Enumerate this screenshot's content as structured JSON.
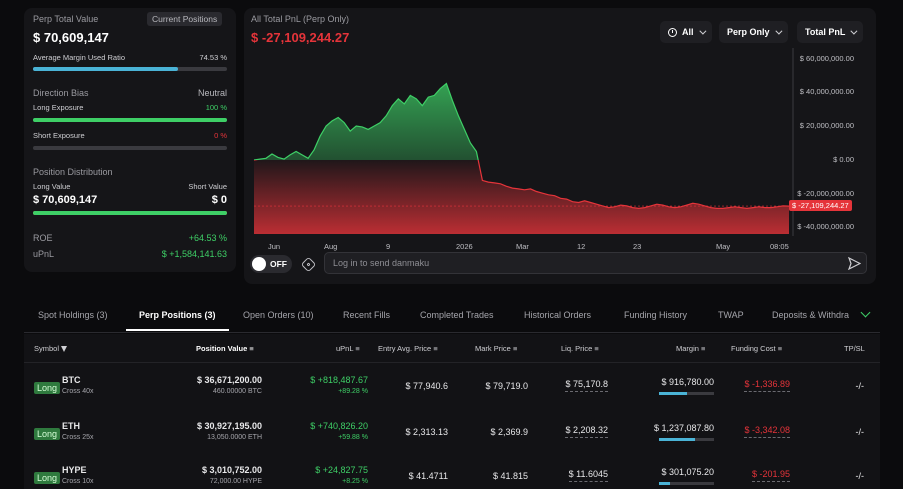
{
  "summary": {
    "perp_total_value_label": "Perp Total Value",
    "current_positions_btn": "Current Positions",
    "perp_total_value": "$ 70,609,147",
    "avg_margin_label": "Average Margin Used Ratio",
    "avg_margin_value": "74.53 %",
    "avg_margin_ratio": 0.7453,
    "direction_bias_label": "Direction Bias",
    "direction_bias_value": "Neutral",
    "long_exposure_label": "Long Exposure",
    "long_exposure_value": "100 %",
    "long_exposure_ratio": 1.0,
    "short_exposure_label": "Short Exposure",
    "short_exposure_value": "0 %",
    "short_exposure_ratio": 0.0,
    "position_distribution_label": "Position Distribution",
    "long_value_label": "Long Value",
    "short_value_label": "Short Value",
    "long_value": "$ 70,609,147",
    "short_value": "$ 0",
    "long_value_ratio": 1.0,
    "roe_label": "ROE",
    "roe_value": "+64.53 %",
    "upnl_label": "uPnL",
    "upnl_value": "$ +1,584,141.63"
  },
  "chart_panel": {
    "title": "All Total PnL (Perp Only)",
    "current_value": "$ -27,109,244.27",
    "filter_all": "All",
    "filter_perp": "Perp Only",
    "filter_total": "Total PnL",
    "current_badge": "$ -27,109,244.27",
    "toggle_label": "OFF",
    "danmaku_placeholder": "Log in to send danmaku"
  },
  "chart_data": {
    "type": "area",
    "title": "All Total PnL (Perp Only)",
    "x_ticks": [
      "Jun",
      "Aug",
      "9",
      "2026",
      "Mar",
      "12",
      "23",
      "May",
      "08:05"
    ],
    "y_ticks": [
      "$ 60,000,000.00",
      "$ 40,000,000.00",
      "$ 20,000,000.00",
      "$ 0.00",
      "$ -20,000,000.00",
      "$ -40,000,000.00"
    ],
    "ylim": [
      -40000000,
      60000000
    ],
    "baseline": -27109244.27,
    "colors": {
      "positive": "#3ecf66",
      "negative": "#e5343a"
    },
    "series": [
      {
        "values": [
          0,
          500000,
          1000000,
          3500000,
          1500000,
          500000,
          3000000,
          5000000,
          3000000,
          1000000,
          6000000,
          14000000,
          20000000,
          23000000,
          25000000,
          22000000,
          17000000,
          20000000,
          19500000,
          18000000,
          20000000,
          22000000,
          26000000,
          32000000,
          36000000,
          33000000,
          38000000,
          36000000,
          32000000,
          37000000,
          38000000,
          42000000,
          45000000,
          35000000,
          26000000,
          18000000,
          10000000,
          5000000,
          -12000000,
          -13000000,
          -13500000,
          -14000000,
          -15500000,
          -16500000,
          -17000000,
          -17500000,
          -17000000,
          -18500000,
          -19500000,
          -20500000,
          -21000000,
          -22500000,
          -23000000,
          -24500000,
          -25000000,
          -24000000,
          -25000000,
          -26000000,
          -27000000,
          -28000000,
          -27500000,
          -26500000,
          -27000000,
          -28000000,
          -28500000,
          -28000000,
          -27000000,
          -26000000,
          -26500000,
          -27500000,
          -28000000,
          -27500000,
          -26500000,
          -25500000,
          -26000000,
          -27000000,
          -28000000,
          -28500000,
          -28500000,
          -28000000,
          -27500000,
          -28000000,
          -28500000,
          -28000000,
          -27500000,
          -28000000,
          -28000000,
          -27500000,
          -27000000,
          -27109244
        ]
      }
    ]
  },
  "tabs": [
    {
      "label": "Spot Holdings (3)"
    },
    {
      "label": "Perp Positions (3)"
    },
    {
      "label": "Open Orders (10)"
    },
    {
      "label": "Recent Fills"
    },
    {
      "label": "Completed Trades"
    },
    {
      "label": "Historical Orders"
    },
    {
      "label": "Funding History"
    },
    {
      "label": "TWAP"
    },
    {
      "label": "Deposits & Withdra"
    }
  ],
  "table": {
    "headers": [
      "Symbol",
      "Position Value",
      "uPnL",
      "Entry Avg. Price",
      "Mark Price",
      "Liq. Price",
      "Margin",
      "Funding Cost",
      "TP/SL"
    ],
    "rows": [
      {
        "tag": "Long",
        "symbol": "BTC",
        "leverage": "Cross 40x",
        "position_value": "$ 36,671,200.00",
        "position_size": "460.00000 BTC",
        "upnl": "$ +818,487.67",
        "upnl_pct": "+89.28 %",
        "entry": "$ 77,940.6",
        "mark": "$ 79,719.0",
        "liq": "$ 75,170.8",
        "margin": "$ 916,780.00",
        "margin_ratio": 0.5,
        "funding": "$ -1,336.89",
        "tpsl": "-/-"
      },
      {
        "tag": "Long",
        "symbol": "ETH",
        "leverage": "Cross 25x",
        "position_value": "$ 30,927,195.00",
        "position_size": "13,050.0000 ETH",
        "upnl": "$ +740,826.20",
        "upnl_pct": "+59.88 %",
        "entry": "$ 2,313.13",
        "mark": "$ 2,369.9",
        "liq": "$ 2,208.32",
        "margin": "$ 1,237,087.80",
        "margin_ratio": 0.65,
        "funding": "$ -3,342.08",
        "tpsl": "-/-"
      },
      {
        "tag": "Long",
        "symbol": "HYPE",
        "leverage": "Cross 10x",
        "position_value": "$ 3,010,752.00",
        "position_size": "72,000.00 HYPE",
        "upnl": "$ +24,827.75",
        "upnl_pct": "+8.25 %",
        "entry": "$ 41.4711",
        "mark": "$ 41.815",
        "liq": "$ 11.6045",
        "margin": "$ 301,075.20",
        "margin_ratio": 0.2,
        "funding": "$ -201.95",
        "tpsl": "-/-"
      }
    ]
  }
}
